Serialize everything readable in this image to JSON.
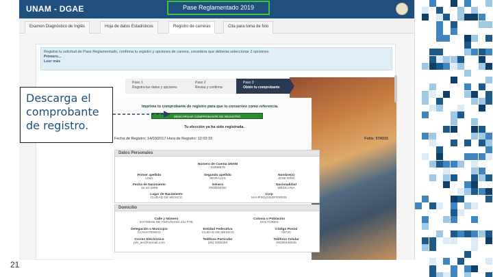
{
  "app": {
    "brand": "UNAM - DGAE",
    "page_title": "Pase Reglamentado 2019",
    "tabs": [
      "Examen Diagnóstico de Inglés",
      "Hoja de datos Estadísticos",
      "Registro de carreras",
      "Cita para toma de foto"
    ],
    "active_tab": 2
  },
  "info": {
    "line1": "Registra tu solicitud de Pase Reglamentado, confirma tu registro y opciones de carrera, considera que deberás seleccionar 2 opciones:",
    "line2": "Primero...",
    "link": "Leer más"
  },
  "steps": [
    {
      "title": "Paso 1",
      "desc": "Registra tus datos y opciones"
    },
    {
      "title": "Paso 2",
      "desc": "Revisa y confirma"
    },
    {
      "title": "Paso 3",
      "desc": "Obtén tu comprobante"
    }
  ],
  "main": {
    "print_message": "Imprime tu comprobante de registro para que lo conserves como referencia.",
    "download_label": "DESCARGAR COMPROBANTE DE REGISTRO",
    "chosen": "Tu elección ya ha sido registrada.",
    "reg_line": "Fecha de Registro: 14/03/2017   Hora de Registro: 12:03:33",
    "folio": "Folio: 574315"
  },
  "personal": {
    "header": "Datos Personales",
    "fields": [
      {
        "label": "Número de Cuenta UNAM",
        "value": "31898878"
      },
      {
        "label": "Primer apellido",
        "value": "LIMA"
      },
      {
        "label": "Segundo apellido",
        "value": "MORALES"
      },
      {
        "label": "Nombre(s)",
        "value": "JOSE ERIK"
      },
      {
        "label": "Fecha de Nacimiento",
        "value": "15-10-1999"
      },
      {
        "label": "Género",
        "value": "FEMENINO"
      },
      {
        "label": "Nacionalidad",
        "value": "MEXICANA"
      },
      {
        "label": "Lugar de Nacimiento",
        "value": "CIUDAD DE MEXICO"
      },
      {
        "label": "Curp",
        "value": "MAHF001231DFRRR05"
      }
    ]
  },
  "domicilio": {
    "header": "Domicilio",
    "fields": [
      {
        "label": "Calle y Número",
        "value": "ESTEBAN DE ANTUÑANO 211 PTE"
      },
      {
        "label": "Colonia o Población",
        "value": "DOCTORES"
      },
      {
        "label": "Delegación o Municipio",
        "value": "CUAUHTEMOC"
      },
      {
        "label": "Entidad Federativa",
        "value": "CIUDAD DE MEXICO"
      },
      {
        "label": "Código Postal",
        "value": "06720"
      },
      {
        "label": "Correo Electrónico",
        "value": "prb_an@hotmail.com"
      },
      {
        "label": "Teléfono Particular",
        "value": "(55) 3265464"
      },
      {
        "label": "Teléfono Celular",
        "value": "(55)65446546"
      }
    ]
  },
  "callout": {
    "text": "Descarga el comprobante de registro."
  },
  "slide": {
    "page_number": "21"
  },
  "colors": {
    "topbar": "#1f4f7d",
    "accent_green": "#2f8a34",
    "callout_text": "#1f4e79"
  }
}
